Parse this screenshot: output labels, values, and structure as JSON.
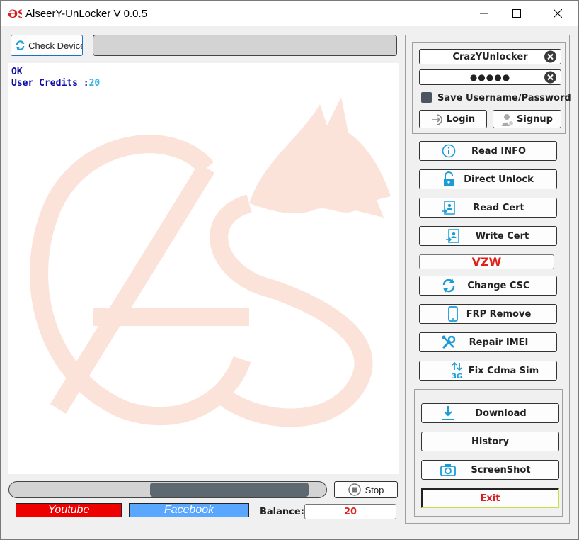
{
  "window": {
    "title": "AlseerY-UnLocker V 0.0.5",
    "icon_text": "ƏS"
  },
  "toolbar": {
    "check_devices_label": "Check Devices",
    "device_field_value": ""
  },
  "log": {
    "lines": [
      {
        "label": "OK",
        "value": ""
      },
      {
        "label": "User Credits :",
        "value": "20"
      }
    ]
  },
  "login": {
    "username": "CrazYUnlocker",
    "password_mask": "●●●●●",
    "save_label": "Save Username/Password",
    "save_checked": false,
    "login_label": "Login",
    "signup_label": "Signup"
  },
  "actions": [
    {
      "label": "Read INFO",
      "icon": "info-icon"
    },
    {
      "label": "Direct Unlock",
      "icon": "unlock-icon"
    },
    {
      "label": "Read Cert",
      "icon": "read-cert-icon"
    },
    {
      "label": "Write Cert",
      "icon": "write-cert-icon"
    },
    {
      "label": "VZW",
      "icon": ""
    },
    {
      "label": "Change CSC",
      "icon": "sync-icon"
    },
    {
      "label": "FRP Remove",
      "icon": "phone-icon"
    },
    {
      "label": "Repair IMEI",
      "icon": "wrench-icon"
    },
    {
      "label": "Fix Cdma Sim",
      "icon": "3g-signal-icon"
    }
  ],
  "bottom_actions": {
    "download_label": "Download",
    "history_label": "History",
    "screenshot_label": "ScreenShot",
    "exit_label": "Exit"
  },
  "progress": {
    "stop_label": "Stop"
  },
  "footer": {
    "youtube_label": "Youtube",
    "facebook_label": "Facebook",
    "balance_label": "Balance:",
    "balance_value": "20"
  },
  "colors": {
    "accent_blue": "#1a9cd8",
    "log_blue": "#0a0aa8",
    "credit_cyan": "#2db5e8",
    "vzw_red": "#e0201a",
    "youtube_red": "#ee0000",
    "facebook_blue": "#5aa7ff",
    "exit_red": "#d42020"
  }
}
